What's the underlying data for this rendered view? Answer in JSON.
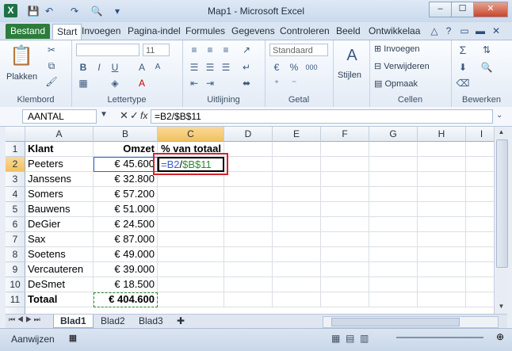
{
  "window": {
    "title": "Map1 - Microsoft Excel",
    "minimize": "–",
    "maximize": "☐",
    "close": "✕"
  },
  "tabs": [
    "Bestand",
    "Start",
    "Invoegen",
    "Pagina-indel",
    "Formules",
    "Gegevens",
    "Controleren",
    "Beeld",
    "Ontwikkelaa"
  ],
  "ribbon": {
    "klembord": {
      "label": "Klembord",
      "plakken": "Plakken"
    },
    "lettertype": {
      "label": "Lettertype",
      "font_size": "11",
      "bold": "B",
      "italic": "I",
      "underline": "U"
    },
    "uitlijning": {
      "label": "Uitlijning"
    },
    "getal": {
      "label": "Getal",
      "format": "Standaard",
      "currency": "€",
      "percent": "%",
      "thousands": "000"
    },
    "stijlen": {
      "label": "Stijlen"
    },
    "cellen": {
      "label": "Cellen",
      "invoegen": "Invoegen",
      "verwijderen": "Verwijderen",
      "opmaak": "Opmaak"
    },
    "bewerken": {
      "label": "Bewerken",
      "sum": "Σ"
    }
  },
  "formula_bar": {
    "namebox": "AANTAL",
    "fx": "fx",
    "formula": "=B2/$B$11"
  },
  "columns": [
    "A",
    "B",
    "C",
    "D",
    "E",
    "F",
    "G",
    "H",
    "I"
  ],
  "rows": [
    {
      "n": "1",
      "a": "Klant",
      "b": "Omzet",
      "c": "% van totaal"
    },
    {
      "n": "2",
      "a": "Peeters",
      "b": "€ 45.600",
      "c": ""
    },
    {
      "n": "3",
      "a": "Janssens",
      "b": "€ 32.800",
      "c": ""
    },
    {
      "n": "4",
      "a": "Somers",
      "b": "€ 57.200",
      "c": ""
    },
    {
      "n": "5",
      "a": "Bauwens",
      "b": "€ 51.000",
      "c": ""
    },
    {
      "n": "6",
      "a": "DeGier",
      "b": "€ 24.500",
      "c": ""
    },
    {
      "n": "7",
      "a": "Sax",
      "b": "€ 87.000",
      "c": ""
    },
    {
      "n": "8",
      "a": "Soetens",
      "b": "€ 49.000",
      "c": ""
    },
    {
      "n": "9",
      "a": "Vercauteren",
      "b": "€ 39.000",
      "c": ""
    },
    {
      "n": "10",
      "a": "DeSmet",
      "b": "€ 18.500",
      "c": ""
    },
    {
      "n": "11",
      "a": "Totaal",
      "b": "€ 404.600",
      "c": ""
    }
  ],
  "editing_cell": {
    "part1": "=B2",
    "part2": "/",
    "part3": "$B$11"
  },
  "sheets": [
    "Blad1",
    "Blad2",
    "Blad3"
  ],
  "status": {
    "mode": "Aanwijzen"
  }
}
